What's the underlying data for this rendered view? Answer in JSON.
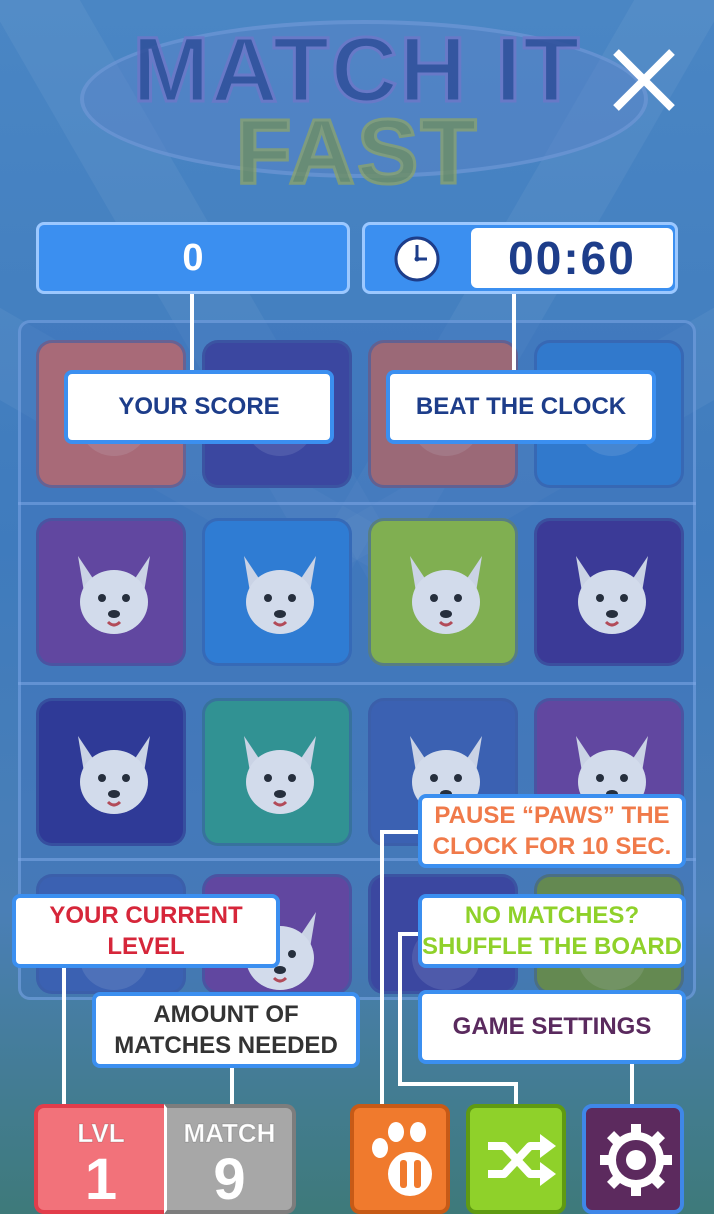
{
  "game": {
    "title_line1": "MATCH IT",
    "title_line2": "FAST",
    "close_icon": "close-icon"
  },
  "hud": {
    "score": "0",
    "timer": "00:60",
    "clock_icon": "clock-icon"
  },
  "board": {
    "rows": 4,
    "cols": 4,
    "tiles": [
      {
        "animal": "hidden-tile",
        "bg": "#c06a6a"
      },
      {
        "animal": "hidden-tile",
        "bg": "#3b3f9a"
      },
      {
        "animal": "hidden-tile",
        "bg": "#b06868"
      },
      {
        "animal": "hidden-tile",
        "bg": "#2f7cd0"
      },
      {
        "animal": "chihuahua-icon",
        "bg": "#6a3f9a"
      },
      {
        "animal": "persian-cat-icon",
        "bg": "#2c7fd8"
      },
      {
        "animal": "doberman-icon",
        "bg": "#8fbd3a"
      },
      {
        "animal": "corgi-icon",
        "bg": "#3b2f8f"
      },
      {
        "animal": "spitz-icon",
        "bg": "#2c2f8f"
      },
      {
        "animal": "calico-cat-icon",
        "bg": "#2f9a8a"
      },
      {
        "animal": "siamese-cat-icon",
        "bg": "#3b5fb0"
      },
      {
        "animal": "white-cat-icon",
        "bg": "#6a3f9a"
      },
      {
        "animal": "hidden-tile",
        "bg": "#3b5fb0"
      },
      {
        "animal": "bulldog-icon",
        "bg": "#6a3f9a"
      },
      {
        "animal": "hidden-tile",
        "bg": "#3b3f9a"
      },
      {
        "animal": "hidden-tile",
        "bg": "#6d8f3a"
      }
    ]
  },
  "callouts": {
    "score": "YOUR SCORE",
    "clock": "BEAT THE CLOCK",
    "pause_line1": "PAUSE “PAWS” THE",
    "pause_line2": "CLOCK FOR 10 SEC.",
    "shuffle_line1": "NO MATCHES?",
    "shuffle_line2": "SHUFFLE THE BOARD",
    "settings": "GAME SETTINGS",
    "level_line1": "YOUR CURRENT",
    "level_line2": "LEVEL",
    "matches_line1": "AMOUNT OF",
    "matches_line2": "MATCHES NEEDED"
  },
  "colors": {
    "callout_blue": "#3b8ff0",
    "score_text": "#1d3d8a",
    "pause_text": "#f07a4a",
    "shuffle_text": "#8fd12a",
    "settings_text": "#5a2a5e",
    "level_text": "#d6263a",
    "matches_text": "#333333"
  },
  "controls": {
    "level_label": "LVL",
    "level_value": "1",
    "match_label": "MATCH",
    "match_value": "9",
    "pause_icon": "paw-pause-icon",
    "shuffle_icon": "shuffle-icon",
    "settings_icon": "gear-icon"
  }
}
